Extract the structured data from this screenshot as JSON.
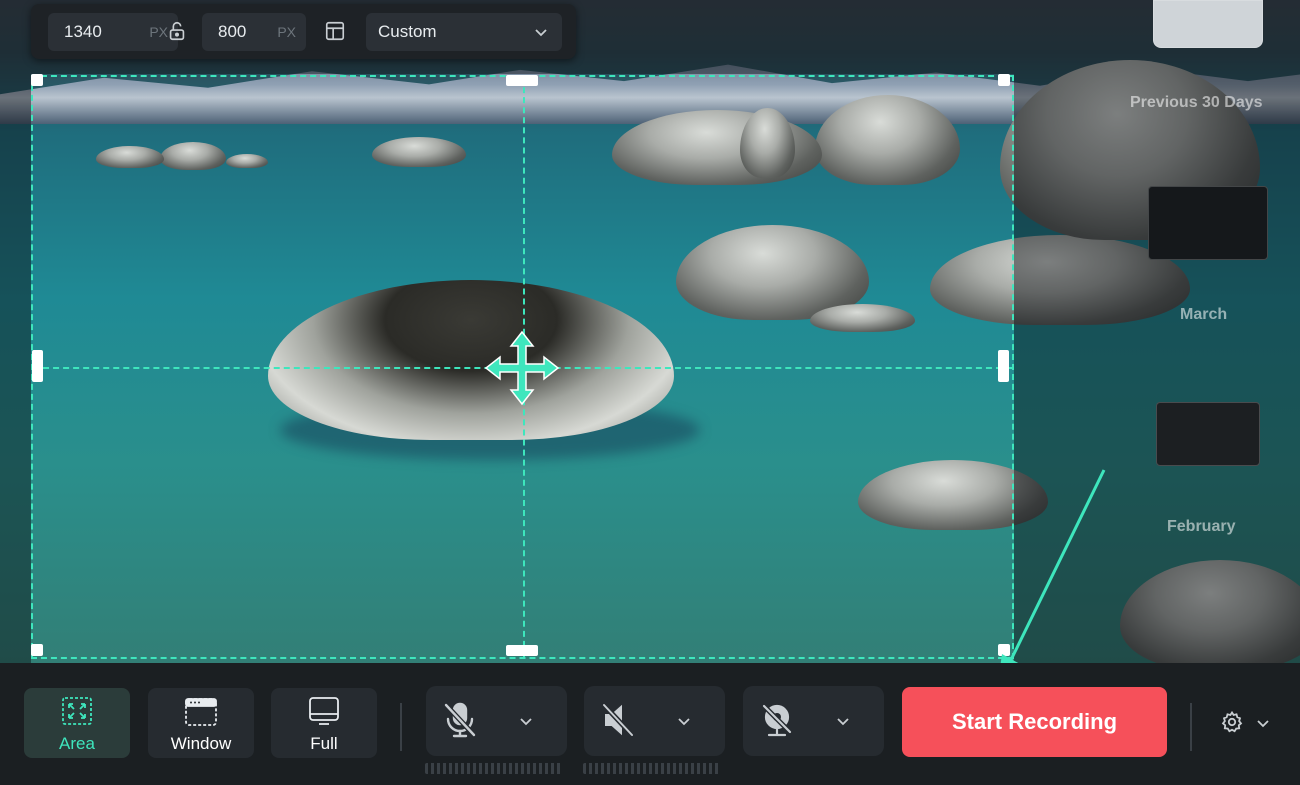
{
  "toolbar": {
    "width_value": "1340",
    "width_unit": "PX",
    "height_value": "800",
    "height_unit": "PX",
    "preset_selected": "Custom"
  },
  "background_timeline": {
    "labels": [
      "Previous 30 Days",
      "March",
      "February"
    ]
  },
  "capture_modes": [
    {
      "label": "Area",
      "icon": "area-capture-icon",
      "active": true
    },
    {
      "label": "Window",
      "icon": "window-capture-icon",
      "active": false
    },
    {
      "label": "Full",
      "icon": "fullscreen-capture-icon",
      "active": false
    }
  ],
  "devices": [
    {
      "icon": "microphone-off-icon"
    },
    {
      "icon": "speaker-muted-icon"
    },
    {
      "icon": "camera-off-icon"
    }
  ],
  "start_button_label": "Start Recording",
  "colors": {
    "accent": "#3ee6bd",
    "record": "#f6505a",
    "bar_bg": "#1b1f22"
  }
}
